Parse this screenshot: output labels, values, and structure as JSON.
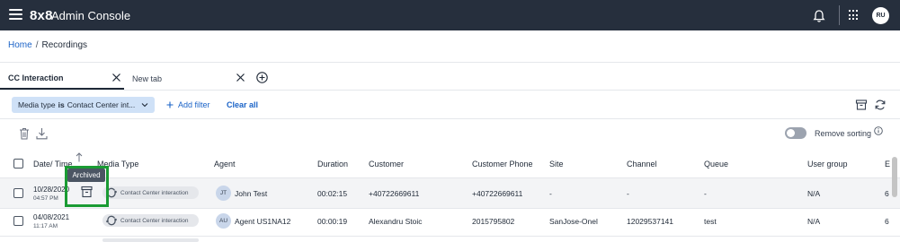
{
  "header": {
    "brand": "8x8",
    "title": "Admin Console",
    "avatar_initials": "RU",
    "background_color": "#262f3d"
  },
  "breadcrumb": {
    "home": "Home",
    "separator": "/",
    "current": "Recordings"
  },
  "tabs": [
    {
      "label": "CC Interaction",
      "active": true
    },
    {
      "label": "New tab",
      "active": false
    }
  ],
  "filters": {
    "chip_prefix": "Media type",
    "chip_operator": "is",
    "chip_value": "Contact Center int...",
    "add_filter_label": "Add filter",
    "clear_all_label": "Clear all"
  },
  "toolbar": {
    "remove_sorting_label": "Remove sorting",
    "remove_sorting_enabled": false
  },
  "table": {
    "columns": [
      "Date/ Time",
      "Media Type",
      "Agent",
      "Duration",
      "Customer",
      "Customer Phone",
      "Site",
      "Channel",
      "Queue",
      "User group",
      "E"
    ],
    "rows": [
      {
        "date": "10/28/2020",
        "time": "04:57 PM",
        "media": "Contact Center interaction",
        "agent_initials": "JT",
        "agent": "John Test",
        "duration": "00:02:15",
        "customer": "+40722669611",
        "phone": "+40722669611",
        "site": "-",
        "channel": "-",
        "queue": "-",
        "user_group": "N/A",
        "extra": "6"
      },
      {
        "date": "04/08/2021",
        "time": "11:17 AM",
        "media": "Contact Center interaction",
        "agent_initials": "AU",
        "agent": "Agent US1NA12",
        "duration": "00:00:19",
        "customer": "Alexandru Stoic",
        "phone": "2015795802",
        "site": "SanJose-Onel",
        "channel": "12029537141",
        "queue": "test",
        "user_group": "N/A",
        "extra": "6"
      }
    ]
  },
  "tooltip": {
    "text": "Archived"
  },
  "colors": {
    "link": "#1b63c7",
    "chip_bg": "#cfe1f7",
    "highlight": "#1a9b33"
  }
}
